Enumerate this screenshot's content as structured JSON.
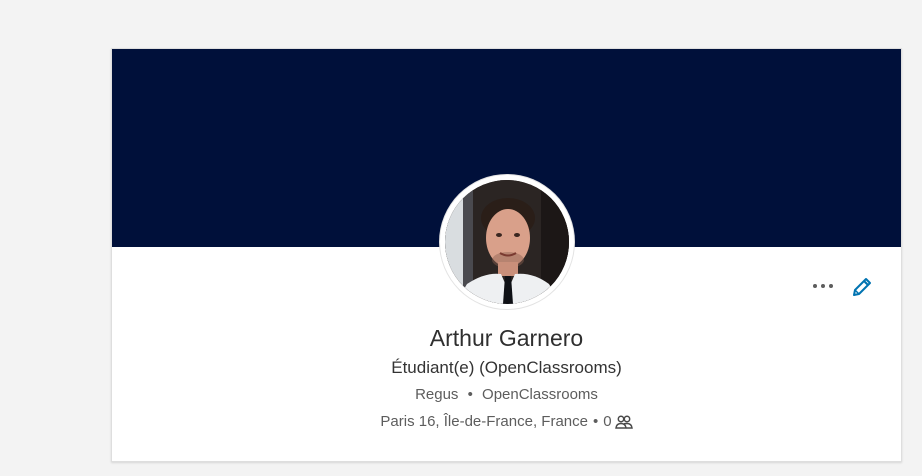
{
  "profile": {
    "name": "Arthur Garnero",
    "headline": "Étudiant(e) (OpenClassrooms)",
    "company": "Regus",
    "school": "OpenClassrooms",
    "location": "Paris 16, Île-de-France, France",
    "connections": "0",
    "separator": "•"
  },
  "colors": {
    "banner": "#00103a",
    "accent": "#0073b1",
    "page_bg": "#f3f3f3"
  },
  "icons": {
    "more": "more-horizontal-icon",
    "edit": "pencil-icon",
    "connections": "people-icon"
  }
}
